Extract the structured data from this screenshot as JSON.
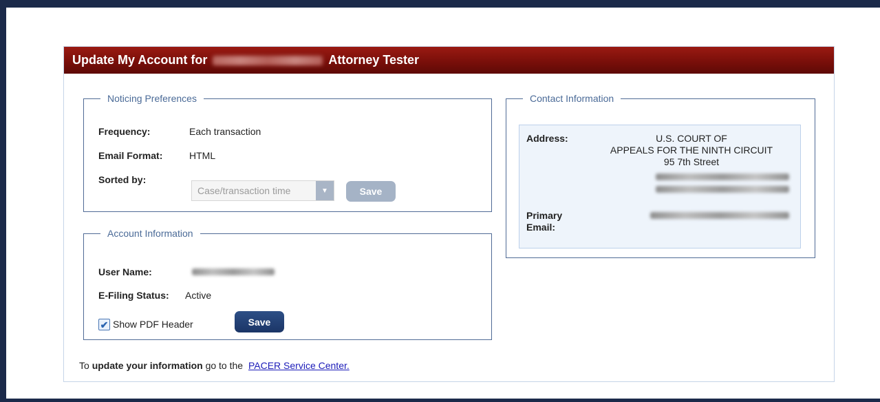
{
  "header": {
    "title_prefix": "Update My Account for",
    "title_suffix": "Attorney Tester"
  },
  "noticing": {
    "legend": "Noticing Preferences",
    "frequency_label": "Frequency:",
    "frequency_value": "Each transaction",
    "email_format_label": "Email Format:",
    "email_format_value": "HTML",
    "sorted_by_label": "Sorted by:",
    "sorted_by_value": "Case/transaction time",
    "save_label": "Save"
  },
  "account": {
    "legend": "Account Information",
    "user_name_label": "User Name:",
    "efiling_label": "E-Filing Status:",
    "efiling_value": "Active",
    "show_pdf_header_label": "Show PDF Header",
    "show_pdf_header_checked": true,
    "save_label": "Save"
  },
  "contact": {
    "legend": "Contact Information",
    "address_label": "Address:",
    "address_line1": "U.S. COURT OF",
    "address_line2": "APPEALS FOR THE NINTH CIRCUIT",
    "address_line3": "95 7th Street",
    "primary_label": "Primary",
    "email_label": "Email:"
  },
  "footer": {
    "prefix": "To",
    "bold": "update your information",
    "middle": "go to the",
    "link": "PACER Service Center."
  },
  "colors": {
    "header_bg": "#7a0f0a",
    "frame_bg": "#1b2a4a",
    "primary_button": "#1b3566",
    "link": "#1a1ab8"
  }
}
